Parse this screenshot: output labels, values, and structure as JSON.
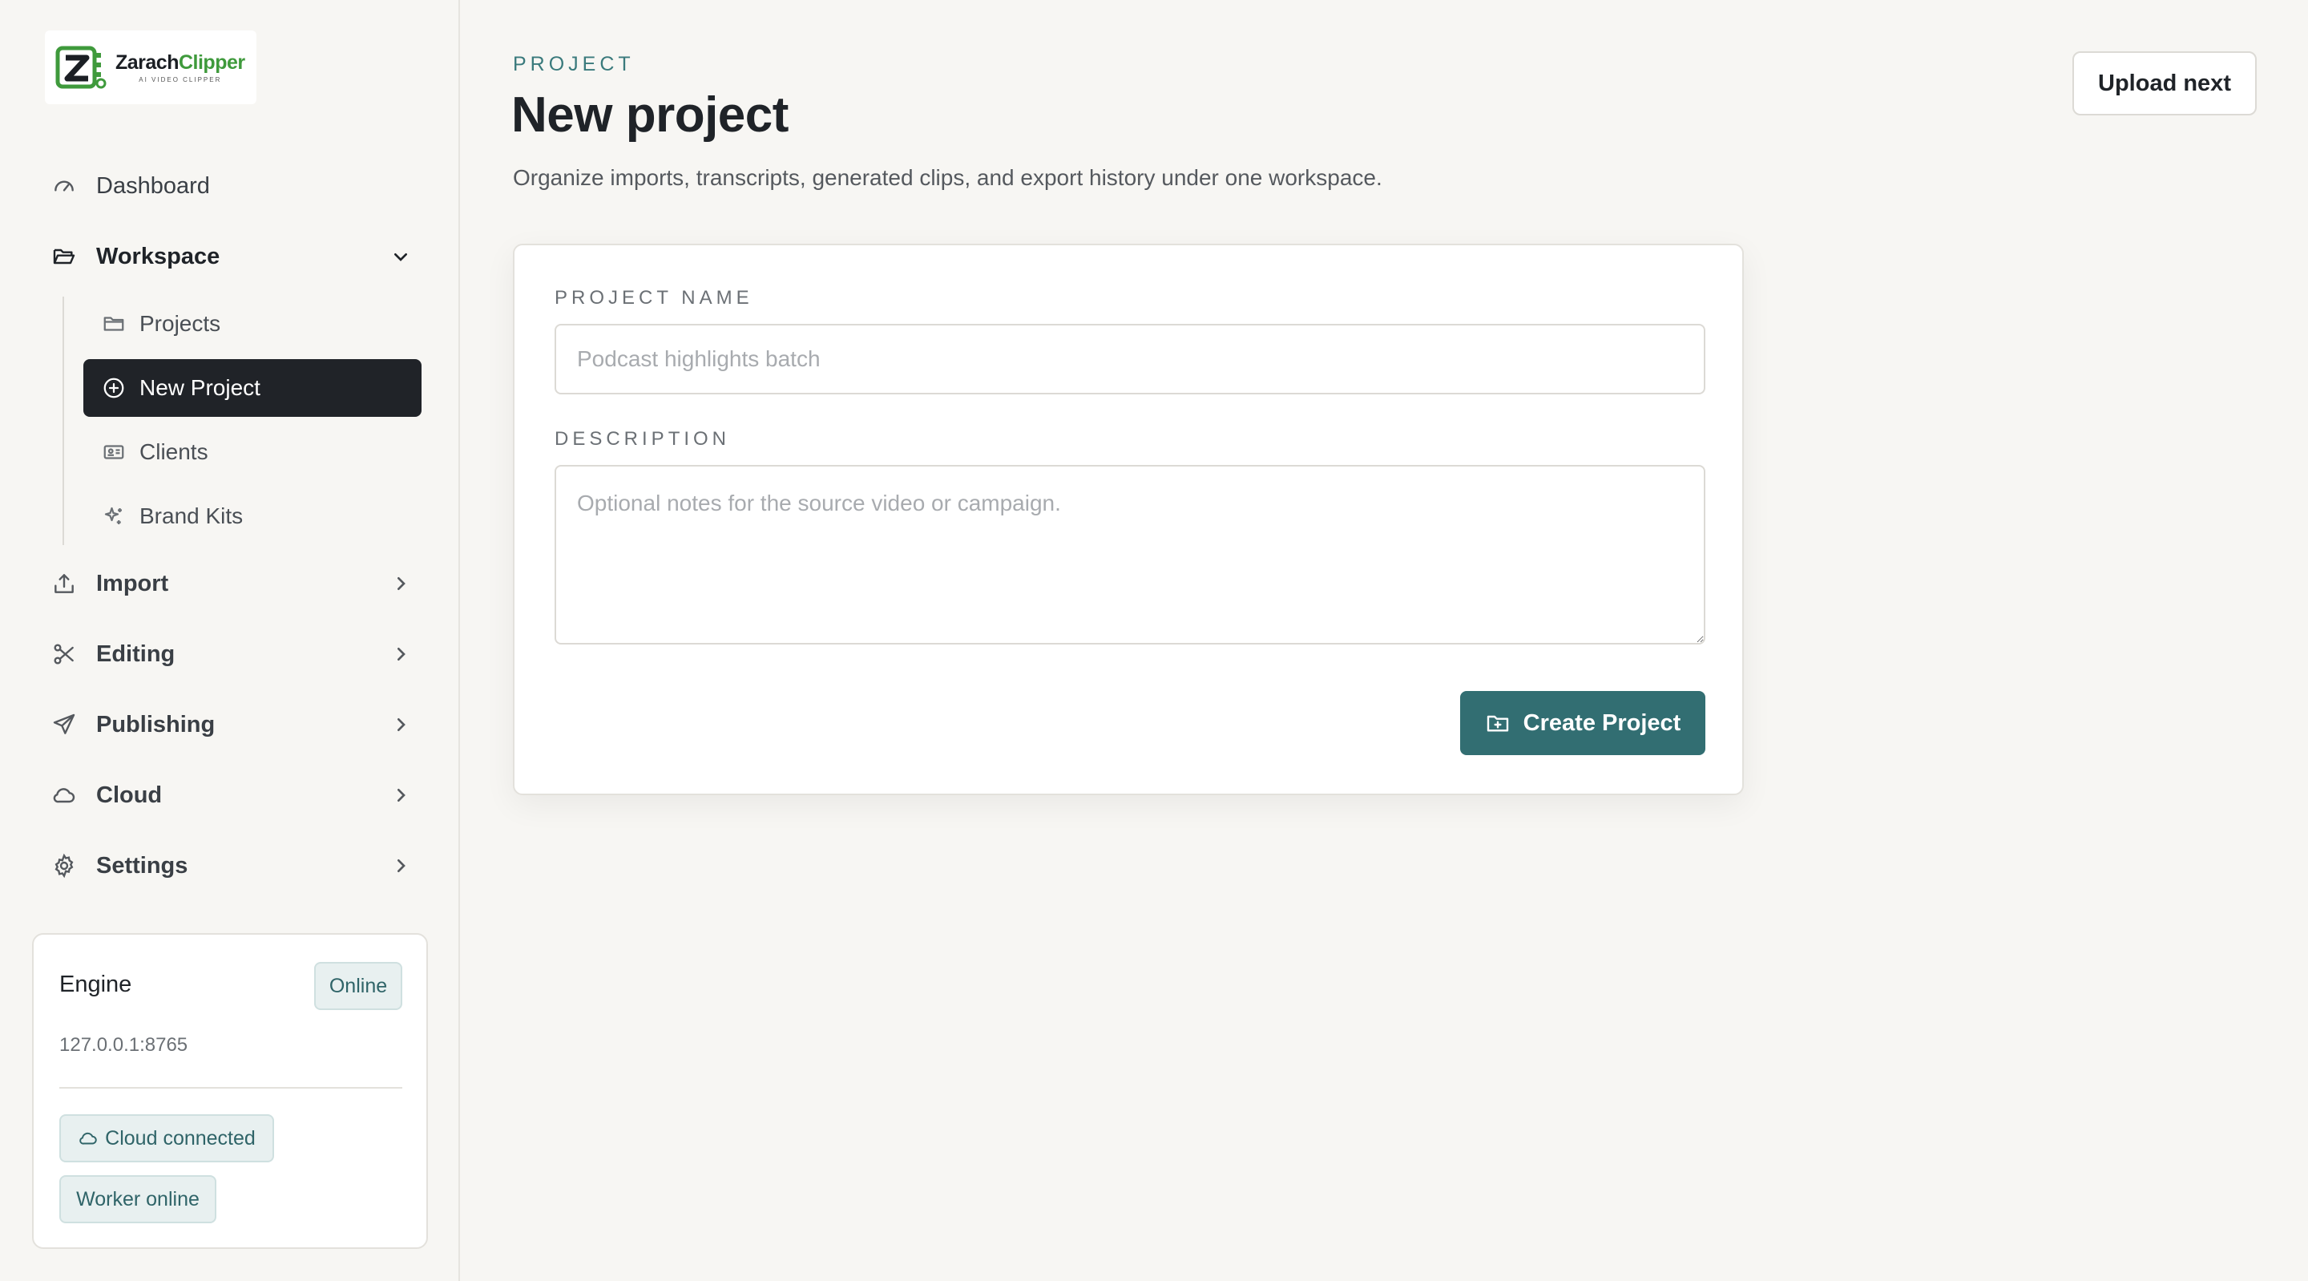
{
  "brand": {
    "name_part1": "Zarach",
    "name_part2": "Clipper",
    "tagline": "AI VIDEO CLIPPER",
    "accent_color": "#3f9a3c"
  },
  "sidebar": {
    "dashboard": {
      "label": "Dashboard",
      "icon": "gauge-icon"
    },
    "workspace": {
      "label": "Workspace",
      "icon": "folder-open-icon",
      "expanded": true,
      "items": [
        {
          "label": "Projects",
          "icon": "folder-icon"
        },
        {
          "label": "New Project",
          "icon": "plus-circle-icon",
          "active": true
        },
        {
          "label": "Clients",
          "icon": "id-card-icon"
        },
        {
          "label": "Brand Kits",
          "icon": "sparkles-icon"
        }
      ]
    },
    "sections": [
      {
        "label": "Import",
        "icon": "upload-icon"
      },
      {
        "label": "Editing",
        "icon": "scissors-icon"
      },
      {
        "label": "Publishing",
        "icon": "send-icon"
      },
      {
        "label": "Cloud",
        "icon": "cloud-icon"
      },
      {
        "label": "Settings",
        "icon": "gear-icon"
      }
    ],
    "engine": {
      "title": "Engine",
      "status": "Online",
      "address": "127.0.0.1:8765",
      "cloud_badge": "Cloud connected",
      "worker_badge": "Worker online"
    }
  },
  "header": {
    "eyebrow": "PROJECT",
    "title": "New project",
    "subtitle": "Organize imports, transcripts, generated clips, and export history under one workspace.",
    "upload_label": "Upload next"
  },
  "form": {
    "name_label": "PROJECT NAME",
    "name_value": "",
    "name_placeholder": "Podcast highlights batch",
    "description_label": "DESCRIPTION",
    "description_value": "",
    "description_placeholder": "Optional notes for the source video or campaign.",
    "submit_label": "Create Project"
  },
  "colors": {
    "primary": "#326e72",
    "active_nav": "#202328",
    "badge_bg": "#e8f0f0",
    "background": "#f7f6f3"
  }
}
